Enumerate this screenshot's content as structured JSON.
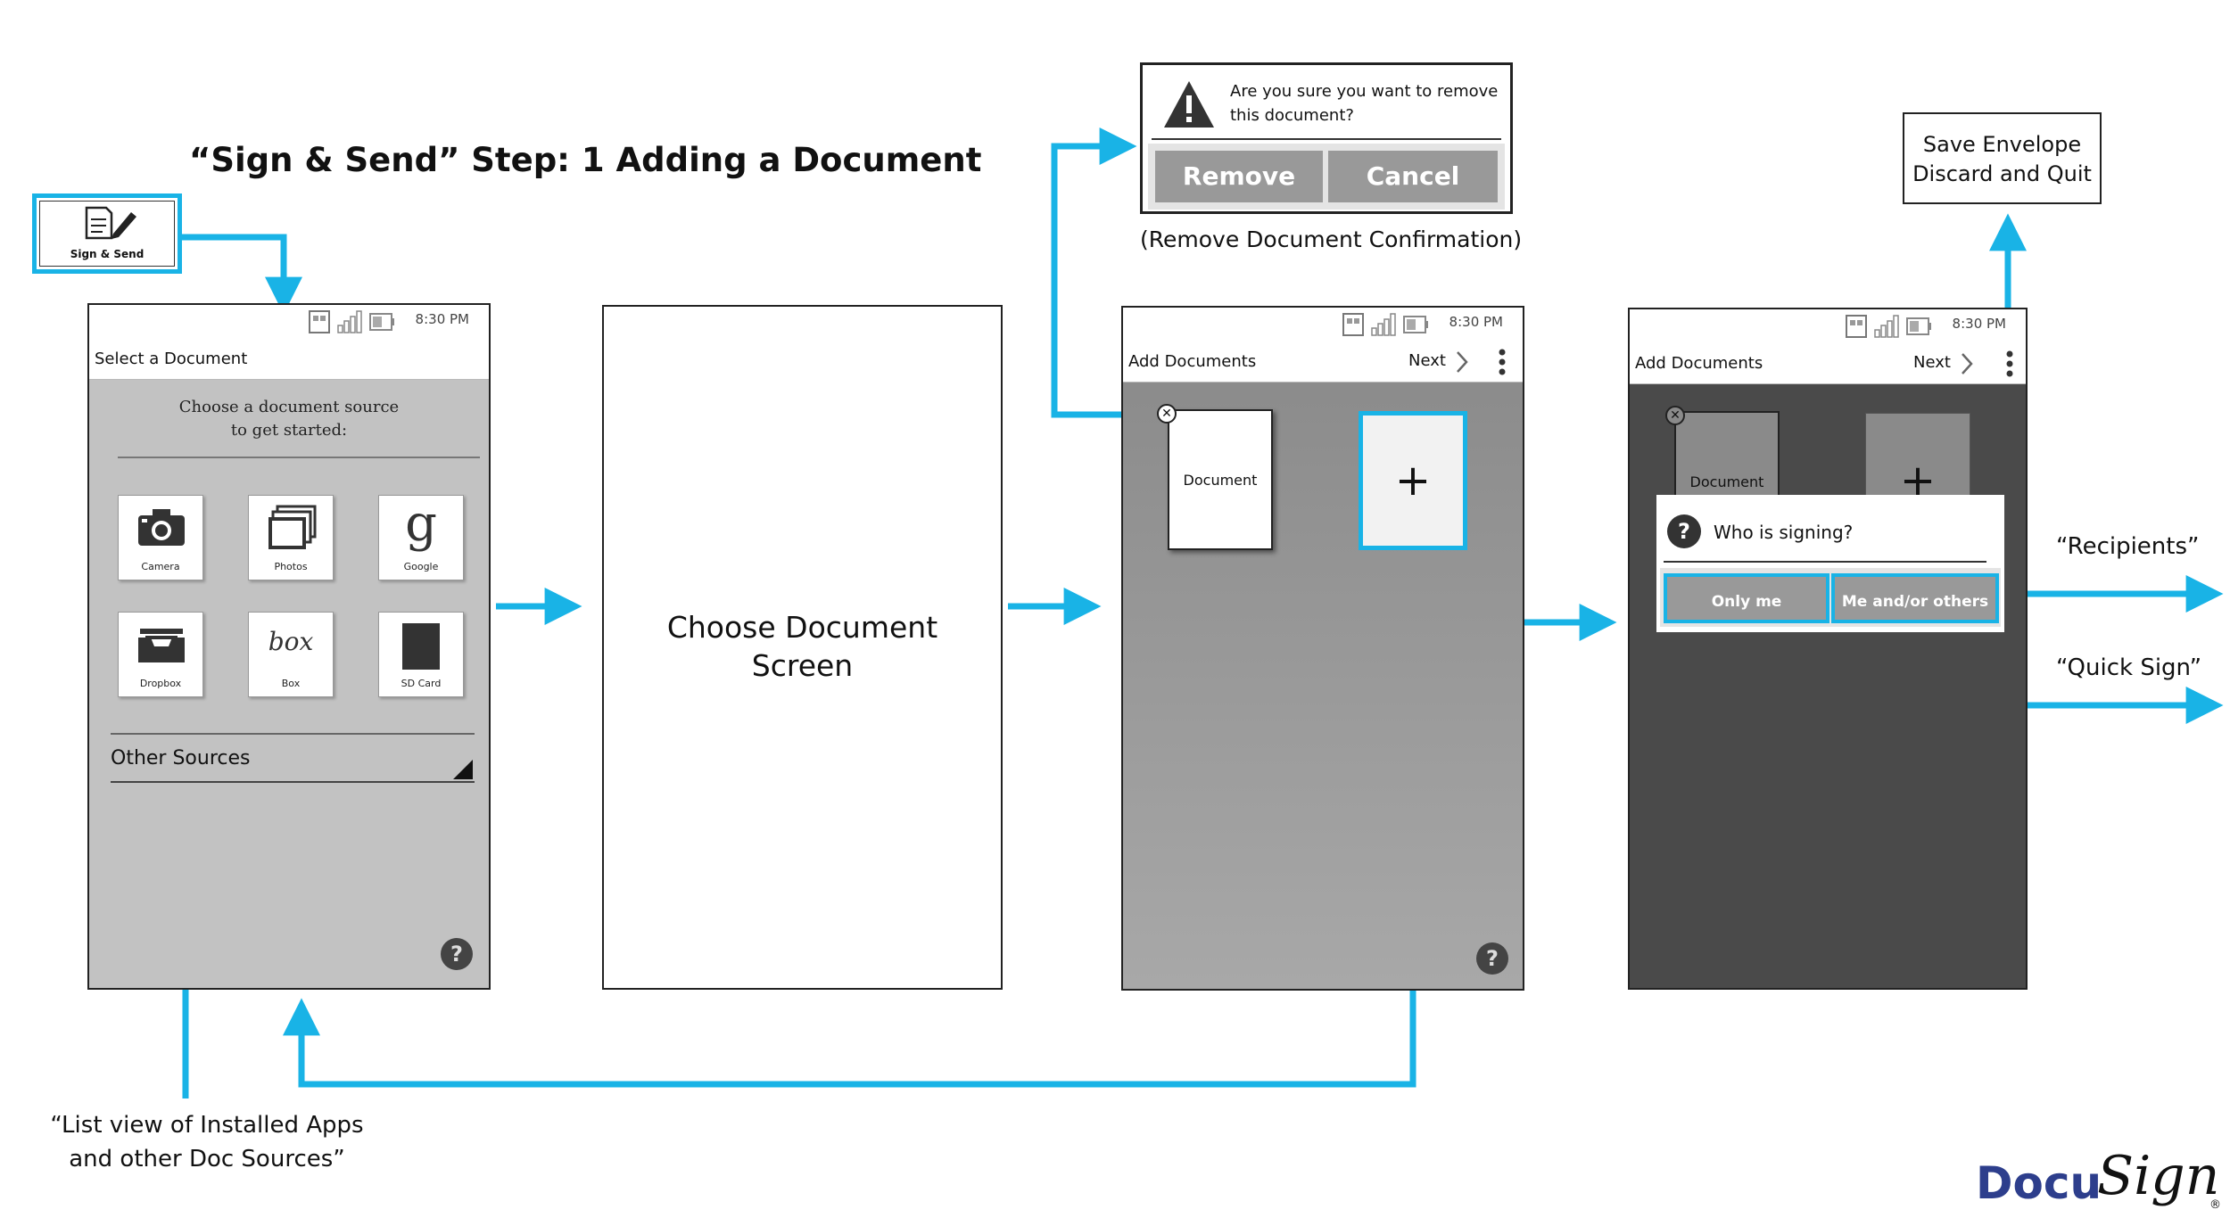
{
  "diagram": {
    "title": "“Sign & Send” Step: 1 Adding a Document",
    "colors": {
      "accent": "#19b3e6",
      "screen_gray": "#c2c2c2",
      "screen_mid": "#8f8f8f",
      "screen_dark": "#4a4a4a",
      "button_gray": "#999999"
    },
    "sign_send_button": {
      "label": "Sign & Send",
      "icon": "document-pen-icon"
    },
    "status_time": "8:30 PM",
    "screen1": {
      "title": "Select a Document",
      "prompt": "Choose a document source\nto get started:",
      "sources": [
        {
          "label": "Camera",
          "icon": "camera-icon"
        },
        {
          "label": "Photos",
          "icon": "photos-icon"
        },
        {
          "label": "Google",
          "icon": "google-icon"
        },
        {
          "label": "Dropbox",
          "icon": "dropbox-icon"
        },
        {
          "label": "Box",
          "icon": "box-icon",
          "glyph": "box"
        },
        {
          "label": "SD Card",
          "icon": "sd-card-icon"
        }
      ],
      "google_glyph": "g",
      "other_sources": "Other Sources",
      "help_glyph": "?"
    },
    "screen2": {
      "text": "Choose Document\nScreen"
    },
    "screen3": {
      "title": "Add Documents",
      "next_label": "Next",
      "doc_label": "Document",
      "plus_glyph": "+",
      "help_glyph": "?"
    },
    "remove_dialog": {
      "message": "Are you sure you want to remove\nthis document?",
      "remove_label": "Remove",
      "cancel_label": "Cancel",
      "caption": "(Remove Document Confirmation)"
    },
    "screen4": {
      "title": "Add Documents",
      "next_label": "Next",
      "doc_label": "Document",
      "plus_glyph": "+",
      "dialog_title": "Who is signing?",
      "only_me": "Only me",
      "me_and_others": "Me and/or others"
    },
    "menu_box": {
      "text": "Save Envelope\nDiscard and Quit"
    },
    "annotations": {
      "recipients": "“Recipients”",
      "quick_sign": "“Quick Sign”",
      "list_view": "“List view of Installed Apps\nand other Doc Sources”"
    },
    "logo": {
      "text_a": "Docu",
      "text_b": "Sign",
      "mark": "®"
    }
  }
}
